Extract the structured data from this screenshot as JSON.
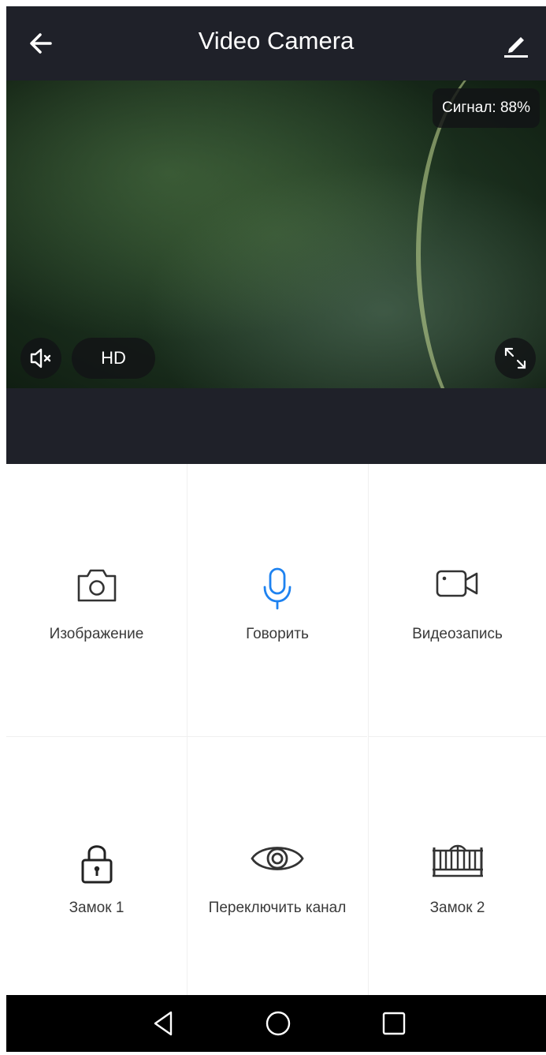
{
  "header": {
    "title": "Video Camera"
  },
  "video": {
    "signal_text": "Сигнал: 88%",
    "quality_label": "HD"
  },
  "controls": [
    {
      "label": "Изображение",
      "icon": "camera-icon"
    },
    {
      "label": "Говорить",
      "icon": "microphone-icon",
      "active": true,
      "color": "#1e82f0"
    },
    {
      "label": "Видеозапись",
      "icon": "video-record-icon"
    },
    {
      "label": "Замок 1",
      "icon": "lock-icon"
    },
    {
      "label": "Переключить канал",
      "icon": "eye-icon"
    },
    {
      "label": "Замок 2",
      "icon": "gate-icon"
    }
  ],
  "colors": {
    "header_bg": "#1f2129",
    "accent": "#1e82f0",
    "icon": "#333333"
  },
  "system_nav": [
    "back-icon",
    "home-icon",
    "recents-icon"
  ]
}
